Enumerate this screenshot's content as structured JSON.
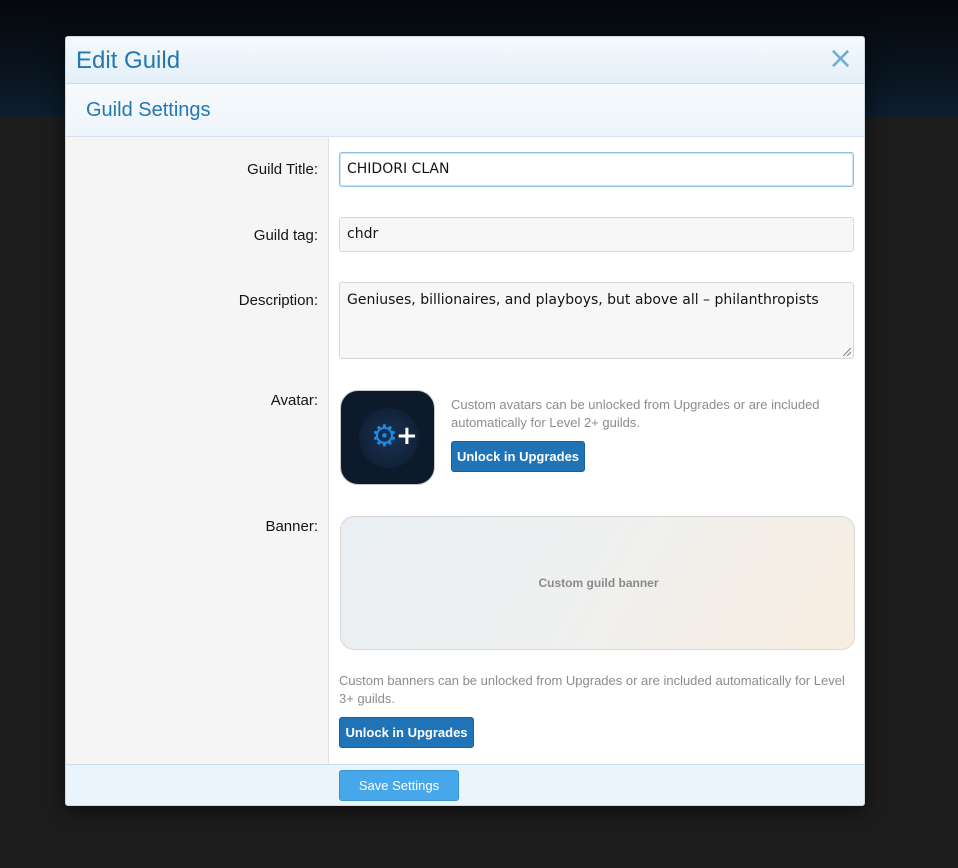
{
  "modal": {
    "title": "Edit Guild",
    "close_icon": "×"
  },
  "section": {
    "title": "Guild Settings"
  },
  "form": {
    "guild_title": {
      "label": "Guild Title:",
      "value": "CHIDORI CLAN"
    },
    "guild_tag": {
      "label": "Guild tag:",
      "value": "chdr"
    },
    "description": {
      "label": "Description:",
      "value": "Geniuses, billionaires, and playboys, but above all – philanthropists"
    },
    "avatar": {
      "label": "Avatar:",
      "hint": "Custom avatars can be unlocked from Upgrades or are included automatically for Level 2+ guilds.",
      "button": "Unlock in Upgrades",
      "icon": "gear-plus-icon"
    },
    "banner": {
      "label": "Banner:",
      "placeholder": "Custom guild banner",
      "hint": "Custom banners can be unlocked from Upgrades or are included automatically for Level 3+ guilds.",
      "button": "Unlock in Upgrades"
    }
  },
  "footer": {
    "save_label": "Save Settings"
  },
  "colors": {
    "accent": "#2577b1",
    "button": "#1f73b7",
    "save_button": "#47a7eb"
  }
}
